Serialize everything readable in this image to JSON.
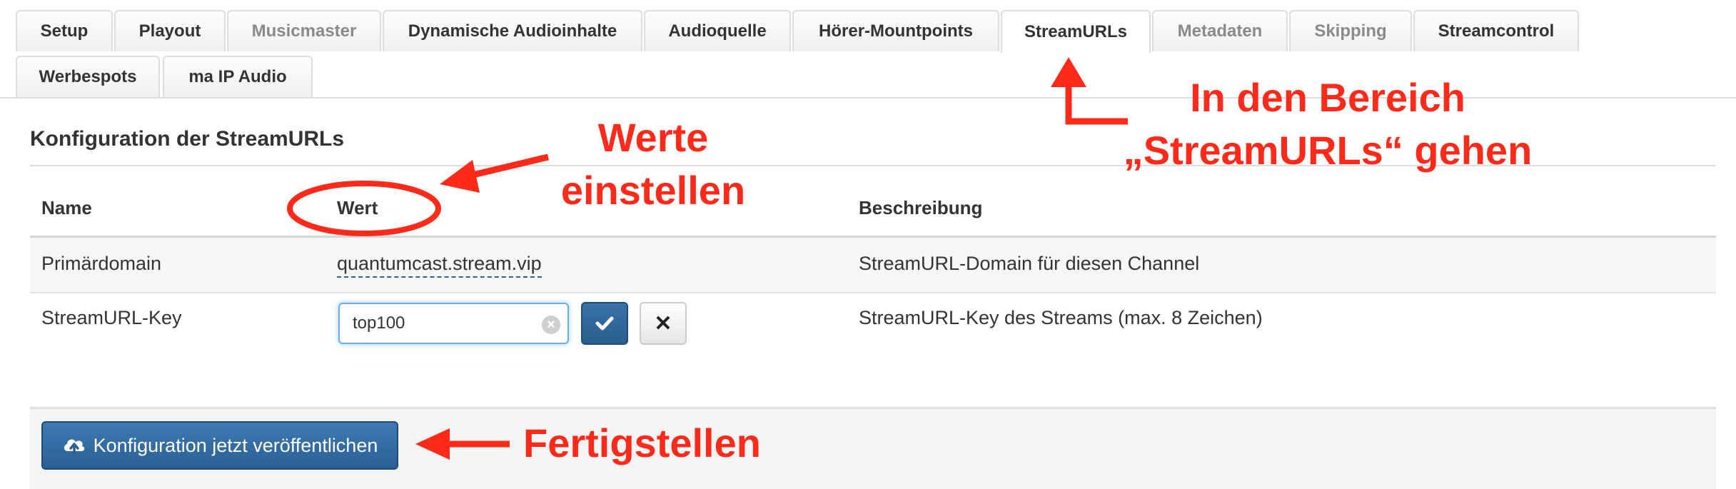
{
  "tabs": [
    {
      "label": "Setup",
      "muted": false
    },
    {
      "label": "Playout",
      "muted": false
    },
    {
      "label": "Musicmaster",
      "muted": true
    },
    {
      "label": "Dynamische Audioinhalte",
      "muted": false
    },
    {
      "label": "Audioquelle",
      "muted": false
    },
    {
      "label": "Hörer-Mountpoints",
      "muted": false
    },
    {
      "label": "StreamURLs",
      "muted": false,
      "active": true
    },
    {
      "label": "Metadaten",
      "muted": true
    },
    {
      "label": "Skipping",
      "muted": true
    },
    {
      "label": "Streamcontrol",
      "muted": false
    },
    {
      "label": "Werbespots",
      "muted": false
    },
    {
      "label": "ma IP Audio",
      "muted": false
    }
  ],
  "section": {
    "title": "Konfiguration der StreamURLs"
  },
  "table": {
    "headers": {
      "name": "Name",
      "value": "Wert",
      "description": "Beschreibung"
    },
    "rows": [
      {
        "name": "Primärdomain",
        "value": "quantumcast.stream.vip",
        "description": "StreamURL-Domain für diesen Channel"
      },
      {
        "name": "StreamURL-Key",
        "value": "top100",
        "description": "StreamURL-Key des Streams (max. 8 Zeichen)"
      }
    ]
  },
  "edit": {
    "confirm_icon": "check-icon",
    "cancel_icon": "close-icon",
    "clear_icon": "clear-circle-icon"
  },
  "footer": {
    "publish_label": "Konfiguration jetzt veröffentlichen",
    "publish_icon": "cloud-upload-icon"
  },
  "annotations": {
    "tab_hint_line1": "In den Bereich",
    "tab_hint_line2": "„StreamURLs“ gehen",
    "value_hint_line1": "Werte",
    "value_hint_line2": "einstellen",
    "finish_hint": "Fertigstellen",
    "color": "#ff2a1a"
  },
  "colors": {
    "primary_button": "#2a6094",
    "focus_border": "#66afe9",
    "tab_border": "#dddddd"
  }
}
